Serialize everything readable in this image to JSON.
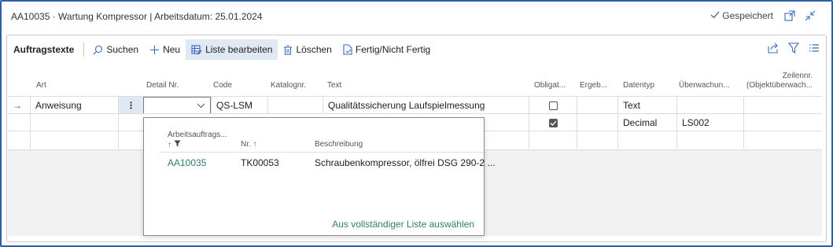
{
  "window": {
    "title": "AA10035 · Wartung Kompressor | Arbeitsdatum: 25.01.2024",
    "saved_label": "Gespeichert"
  },
  "toolbar": {
    "tab_title": "Auftragstexte",
    "search_label": "Suchen",
    "new_label": "Neu",
    "edit_list_label": "Liste bearbeiten",
    "delete_label": "Löschen",
    "done_label": "Fertig/Nicht Fertig"
  },
  "columns": {
    "art": "Art",
    "detail": "Detail Nr.",
    "code": "Code",
    "katalog": "Katalognr.",
    "text": "Text",
    "obligat": "Obligat...",
    "ergeb": "Ergeb...",
    "datentyp": "Datentyp",
    "ueberwachung": "Überwachun...",
    "zeilennr_1": "Zeilennr.",
    "zeilennr_2": "(Objektüberwach..."
  },
  "rows": [
    {
      "marker": "→",
      "art": "Anweisung",
      "detail": "",
      "code": "QS-LSM",
      "katalog": "",
      "text": "Qualitätssicherung Laufspielmessung",
      "obligat": false,
      "datentyp": "Text",
      "ueberwachung": ""
    },
    {
      "marker": "",
      "art": "",
      "detail": "",
      "code": "",
      "katalog": "",
      "text": "",
      "obligat": true,
      "datentyp": "Decimal",
      "ueberwachung": "LS002"
    }
  ],
  "dropdown": {
    "col_arbeitsauftrag": "Arbeitsauftrags...",
    "col_arbeitsauftrag_sort": "↑",
    "col_nr": "Nr. ↑",
    "col_beschreibung": "Beschreibung",
    "row": {
      "arbeitsauftrag": "AA10035",
      "nr": "TK00053",
      "beschreibung": "Schraubenkompressor, ölfrei DSG 290-2 ..."
    },
    "footer_link": "Aus vollständiger Liste auswählen"
  },
  "colors": {
    "accent": "#3a6bb5",
    "link": "#2e7d6f",
    "frame": "#2b5fa8"
  }
}
